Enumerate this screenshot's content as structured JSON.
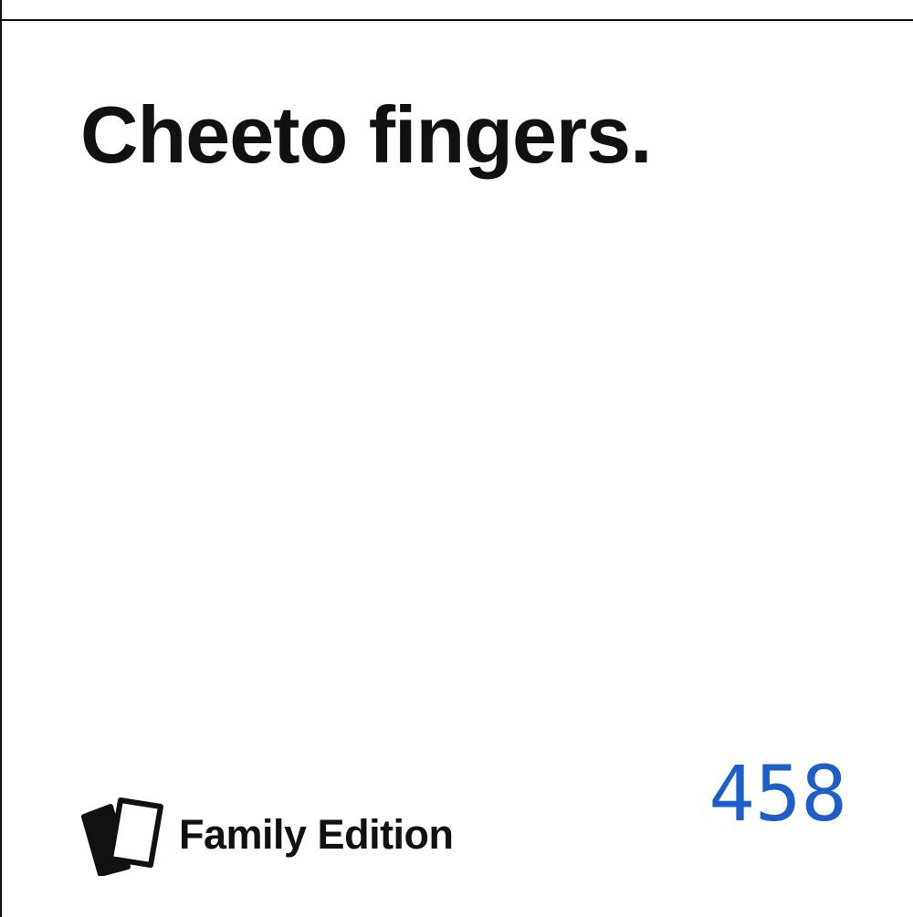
{
  "card": {
    "text": "Cheeto fingers.",
    "edition_label": "Family Edition",
    "logo_icon": "stacked-cards-icon"
  },
  "annotation": {
    "number": "458",
    "color": "#1a5fcc"
  }
}
